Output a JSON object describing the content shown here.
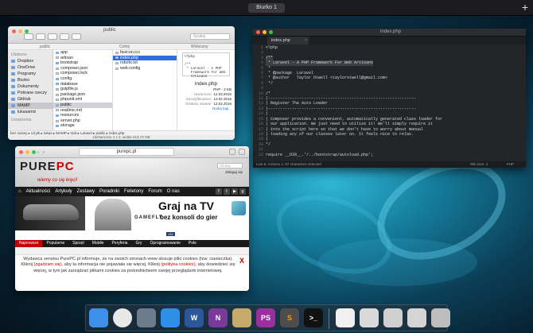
{
  "desktop": {
    "space_label": "Biurko 1",
    "add_space": "+"
  },
  "finder": {
    "title": "public",
    "search_placeholder": "Szukaj",
    "col_headers": [
      "public",
      "Cofnij",
      "Widoczny"
    ],
    "sidebar_sections": [
      "Ulubione",
      "Urządzenia"
    ],
    "sidebar_items": [
      "Dropbox",
      "OneDrive",
      "Programy",
      "Biurko",
      "Dokumenty",
      "Pobrane rzeczy",
      "GitHub",
      "MAMP",
      "lukasamd"
    ],
    "col1": [
      "app",
      "artisan",
      "bootstrap",
      "composer.json",
      "composer.lock",
      "config",
      "database",
      "gulpfile.js",
      "package.json",
      "phpunit.xml",
      "public",
      "readme.md",
      "resources",
      "server.php",
      "storage"
    ],
    "col2": [
      "favicon.ico",
      "index.php",
      "robots.txt",
      "web.config"
    ],
    "preview_code": "<?php\n\n/**\n * Laravel - A PHP\n   Framework For Web\n   Artisans",
    "preview_name": "index.php",
    "preview_kind": "PHP - 2 KB",
    "meta": [
      {
        "label": "Utworzono",
        "value": "12.02.2016"
      },
      {
        "label": "Zmodyfikowano",
        "value": "12.02.2016"
      },
      {
        "label": "Ostatnio otwarte",
        "value": "12.02.2016"
      }
    ],
    "add_tags": "Dodaj tagi...",
    "path": "bez nazwy ▸ Użytk ▸ lukas ▸ MAMP ▸ mdr ▸ Laravel ▸ public ▸ index.php",
    "status": "zaznaczono 1 z 4, wolne 413,74 GB"
  },
  "editor": {
    "window_title": "index.php",
    "tab": "index.php",
    "tab_close": "×",
    "lines": [
      "<?php",
      "",
      "/**",
      " * Laravel - A PHP Framework For Web Artisans",
      " *",
      " * @package  Laravel",
      " * @author   Taylor Otwell <taylorotwell@gmail.com>",
      " */",
      "",
      "/*",
      "|--------------------------------------------------------------",
      "| Register The Auto Loader",
      "|--------------------------------------------------------------",
      "|",
      "| Composer provides a convenient, automatically generated class loader for",
      "| our application. We just need to utilize it! We'll simply require it",
      "| into the script here so that we don't have to worry about manual",
      "| loading any of our classes later on. It feels nice to relax.",
      "|",
      "*/",
      "",
      "require __DIR__.'/../bootstrap/autoload.php';"
    ],
    "status": "Line 5, Column 1; 57 characters selected",
    "tab_size": "Tab Size: 4",
    "syntax": "PHP"
  },
  "browser": {
    "url": "purepc.pl",
    "site": {
      "logo_a": "PURE",
      "logo_b": "PC",
      "slogan": "wiemy co się kręci!",
      "search_placeholder": "Szukaj",
      "login": "Zaloguj się",
      "nav": [
        "Aktualności",
        "Artykuły",
        "Zestawy",
        "Poradniki",
        "Felietony",
        "Forum",
        "O nas"
      ],
      "ad_brand": "GAMEFLY",
      "ad_title": "Graj na TV",
      "ad_sub": "bez konsoli do gier",
      "ad_tag": "132",
      "cats": [
        "Najnowsze",
        "Popularne",
        "Sprzęt",
        "Mobile",
        "Peryferia",
        "Gry",
        "Oprogramowanie",
        "Pole"
      ],
      "cookie_text_1": "Wydawca serwisu PurePC.pl informuje, że na swoich stronach www stosuje pliki cookies (tzw. ciasteczka). Kliknij",
      "cookie_link_1": "(zgadzam się)",
      "cookie_text_2": ", aby ta informacja nie pojawiała się więcej. Kliknij",
      "cookie_link_2": "(polityka cookies)",
      "cookie_text_3": ", aby dowiedzieć się więcej, w tym jak zarządzać plikami cookies za pośrednictwem swojej przeglądarki internetowej.",
      "close": "X"
    }
  },
  "dock": {
    "apps": [
      {
        "name": "finder",
        "label": "",
        "color": "#3d8fe8"
      },
      {
        "name": "chrome",
        "label": "",
        "color": "#e8e8e8"
      },
      {
        "name": "launchpad",
        "label": "",
        "color": "#6c7c8c"
      },
      {
        "name": "safari",
        "label": "",
        "color": "#2f8fe6"
      },
      {
        "name": "word",
        "label": "W",
        "color": "#2b579a"
      },
      {
        "name": "onenote",
        "label": "N",
        "color": "#7a3a9a"
      },
      {
        "name": "archiver",
        "label": "",
        "color": "#c7a96a"
      },
      {
        "name": "phpstorm",
        "label": "PS",
        "color": "#9b2f9f"
      },
      {
        "name": "sublime",
        "label": "S",
        "color": "#4d4d4d"
      },
      {
        "name": "terminal",
        "label": ">_",
        "color": "#111"
      },
      {
        "name": "document",
        "label": "",
        "color": "#f0f0f0"
      },
      {
        "name": "window-1",
        "label": "",
        "color": "#d9d9d9"
      },
      {
        "name": "window-2",
        "label": "",
        "color": "#cfcfcf"
      },
      {
        "name": "window-3",
        "label": "",
        "color": "#d5d5d5"
      },
      {
        "name": "trash",
        "label": "",
        "color": "#bdbdbd"
      }
    ]
  }
}
